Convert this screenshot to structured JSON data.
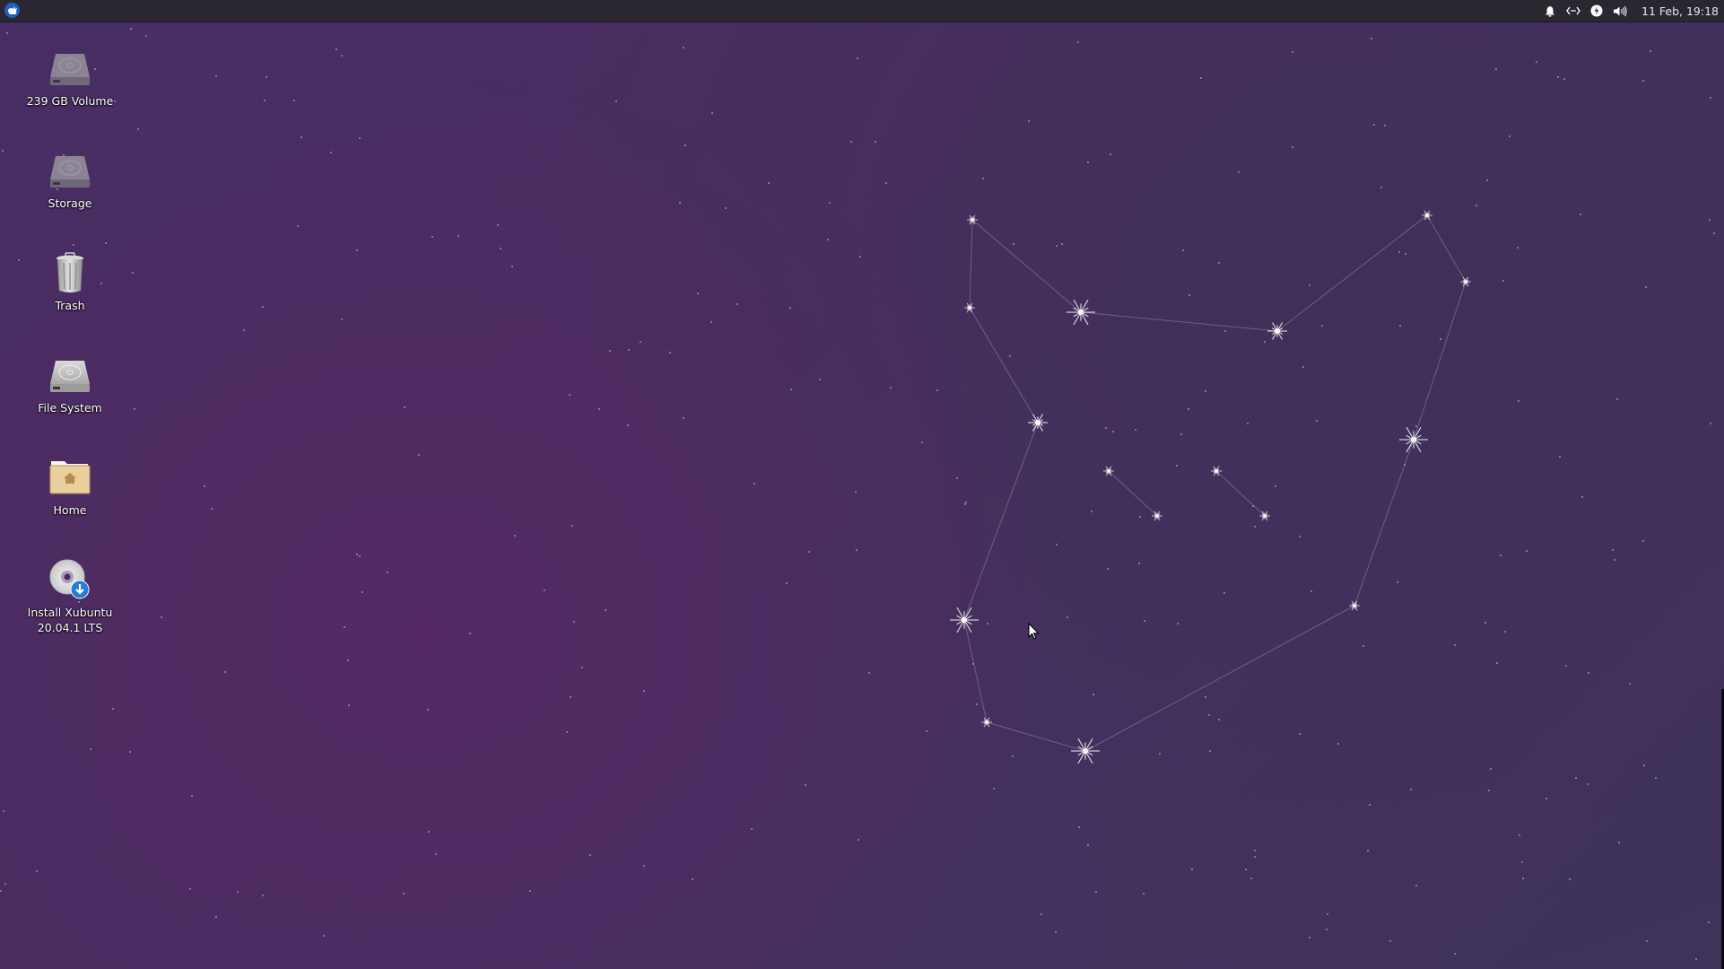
{
  "panel": {
    "app_menu_icon": "xubuntu-whisker-menu-icon",
    "tray": {
      "notifications_icon": "bell-icon",
      "network_icon": "network-disconnected-icon",
      "power_icon": "power-lightning-icon",
      "volume_icon": "speaker-volume-icon"
    },
    "clock": "11 Feb, 19:18"
  },
  "desktop_icons": [
    {
      "label": "239 GB Volume",
      "icon": "hard-drive-icon"
    },
    {
      "label": "Storage",
      "icon": "hard-drive-icon"
    },
    {
      "label": "Trash",
      "icon": "trash-icon"
    },
    {
      "label": "File System",
      "icon": "hard-drive-icon"
    },
    {
      "label": "Home",
      "icon": "home-folder-icon"
    },
    {
      "label": "Install Xubuntu 20.04.1 LTS",
      "label_line1": "Install Xubuntu",
      "label_line2": "20.04.1 LTS",
      "icon": "install-disc-icon"
    }
  ],
  "colors": {
    "panel_bg": "#2a2731",
    "wallpaper_center": "#552a64",
    "wallpaper_edge": "#3e3359",
    "accent_blue": "#1f5fc2"
  }
}
